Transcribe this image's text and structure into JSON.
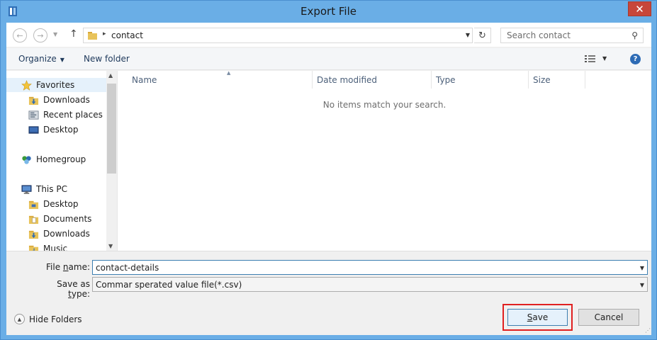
{
  "window": {
    "title": "Export File",
    "close_glyph": "✕"
  },
  "address": {
    "path": "contact",
    "search_placeholder": "Search contact"
  },
  "toolbar": {
    "organize": "Organize",
    "new_folder": "New folder",
    "help_glyph": "?"
  },
  "nav": {
    "favorites": "Favorites",
    "downloads": "Downloads",
    "recent_places": "Recent places",
    "desktop": "Desktop",
    "homegroup": "Homegroup",
    "this_pc": "This PC",
    "pc_desktop": "Desktop",
    "pc_documents": "Documents",
    "pc_downloads": "Downloads",
    "pc_music": "Music"
  },
  "columns": {
    "name": "Name",
    "date_modified": "Date modified",
    "type": "Type",
    "size": "Size"
  },
  "empty_message": "No items match your search.",
  "form": {
    "file_name_label_pre": "File ",
    "file_name_label_key": "n",
    "file_name_label_post": "ame:",
    "file_name_value": "contact-details",
    "save_type_label_pre": "Save as ",
    "save_type_label_key": "t",
    "save_type_label_post": "ype:",
    "save_type_value": "Commar sperated value file(*.csv)"
  },
  "footer": {
    "hide_folders": "Hide Folders",
    "save_key": "S",
    "save_rest": "ave",
    "cancel": "Cancel"
  },
  "colors": {
    "title_bar": "#6aaee6",
    "close": "#c7463a",
    "highlight": "#e02020",
    "folder": "#e8c35a"
  }
}
